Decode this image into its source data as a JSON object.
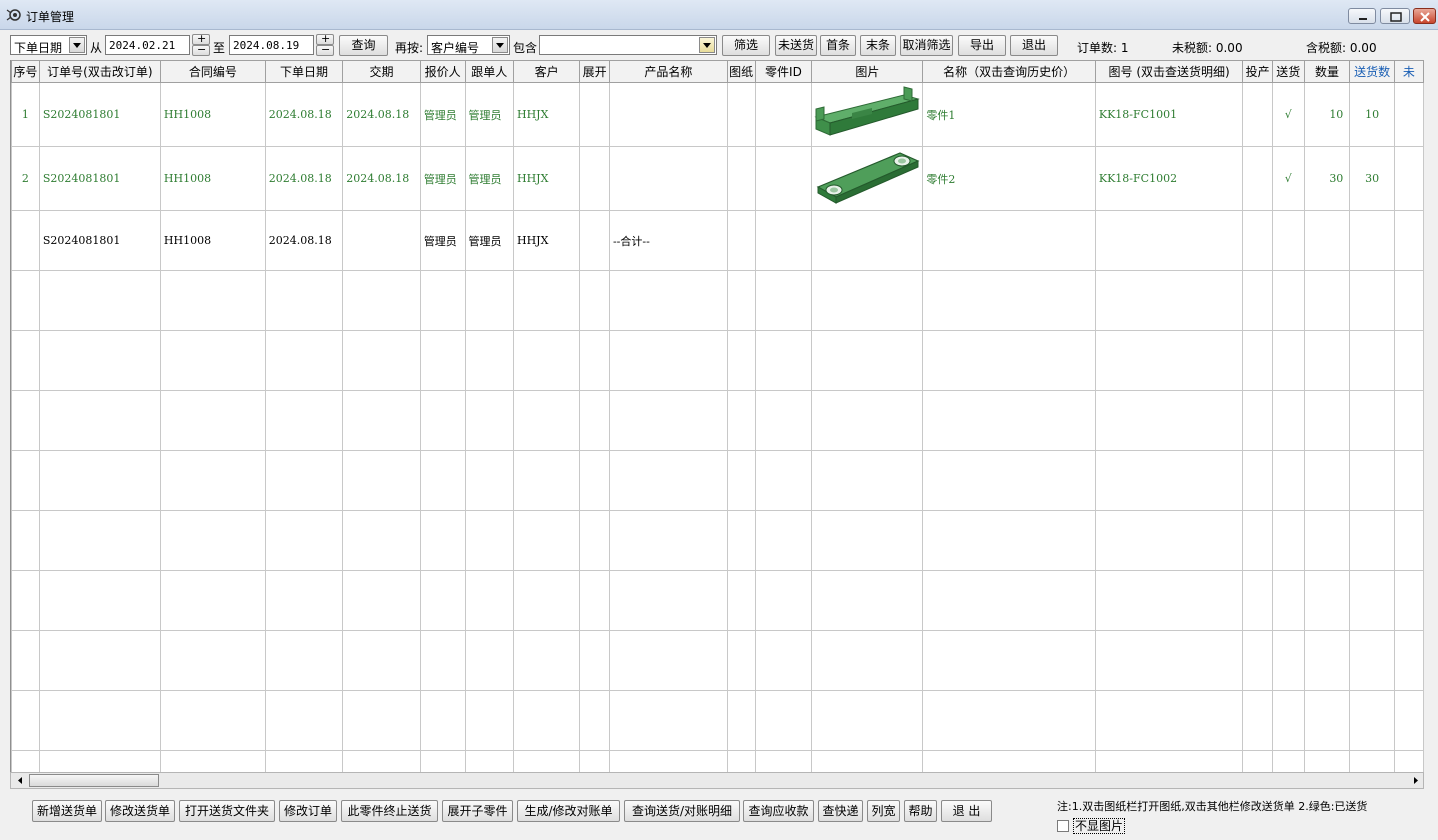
{
  "window": {
    "title": "订单管理"
  },
  "toolbar": {
    "date_field": "下单日期",
    "from_label": "从",
    "date_from": "2024.02.21",
    "to_label": "至",
    "date_to": "2024.08.19",
    "query_label": "查询",
    "filter_by_label": "再按:",
    "filter_field": "客户编号",
    "contains_label": "包含",
    "contains_value": "",
    "filter_label": "筛选",
    "unshipped_label": "未送货",
    "first_label": "首条",
    "last_label": "末条",
    "cancel_filter_label": "取消筛选",
    "export_label": "导出",
    "exit_label": "退出",
    "order_count": "订单数: 1",
    "pretax_amount": "未税额: 0.00",
    "tax_amount": "含税额: 0.00"
  },
  "grid": {
    "columns": [
      "序号",
      "订单号(双击改订单)",
      "合同编号",
      "下单日期",
      "交期",
      "报价人",
      "跟单人",
      "客户",
      "展开",
      "产品名称",
      "图纸",
      "零件ID",
      "图片",
      "名称（双击查询历史价）",
      "图号 (双击查送货明细)",
      "投产",
      "送货",
      "数量",
      "送货数",
      "未"
    ],
    "rows": [
      {
        "seq": "1",
        "order_no": "S2024081801",
        "contract": "HH1008",
        "order_date": "2024.08.18",
        "due_date": "2024.08.18",
        "quoter": "管理员",
        "follower": "管理员",
        "customer": "HHJX",
        "expand": "",
        "product": "",
        "drawing": "",
        "part_id": "",
        "picture": "part-bracket-image",
        "name": "零件1",
        "drawing_no": "KK18-FC1001",
        "production": "",
        "delivered": "√",
        "qty": "10",
        "delivered_qty": "10"
      },
      {
        "seq": "2",
        "order_no": "S2024081801",
        "contract": "HH1008",
        "order_date": "2024.08.18",
        "due_date": "2024.08.18",
        "quoter": "管理员",
        "follower": "管理员",
        "customer": "HHJX",
        "expand": "",
        "product": "",
        "drawing": "",
        "part_id": "",
        "picture": "part-plate-image",
        "name": "零件2",
        "drawing_no": "KK18-FC1002",
        "production": "",
        "delivered": "√",
        "qty": "30",
        "delivered_qty": "30"
      },
      {
        "seq": "",
        "order_no": "S2024081801",
        "contract": "HH1008",
        "order_date": "2024.08.18",
        "due_date": "",
        "quoter": "管理员",
        "follower": "管理员",
        "customer": "HHJX",
        "expand": "",
        "product": "--合计--",
        "drawing": "",
        "part_id": "",
        "picture": "",
        "name": "",
        "drawing_no": "",
        "production": "",
        "delivered": "",
        "qty": "",
        "delivered_qty": ""
      }
    ]
  },
  "bottom": {
    "buttons": [
      "新增送货单",
      "修改送货单",
      "打开送货文件夹",
      "修改订单",
      "此零件终止送货",
      "展开子零件",
      "生成/修改对账单",
      "查询送货/对账明细",
      "查询应收款",
      "查快递",
      "列宽",
      "帮助",
      "退 出"
    ],
    "note": "注:1.双击图纸栏打开图纸,双击其他栏修改送货单 2.绿色:已送货",
    "hide_pictures_label": "不显图片"
  },
  "colors": {
    "green_text": "#2f7d32",
    "blue_header": "#1a5fb4",
    "part_green": "#3f8f4a"
  }
}
